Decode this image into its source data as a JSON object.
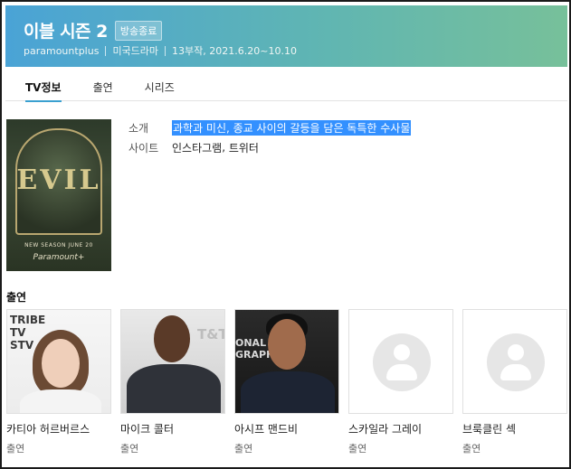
{
  "header": {
    "title": "이블 시즌 2",
    "badge": "방송종료",
    "network": "paramountplus",
    "genre": "미국드라마",
    "episodes_dates": "13부작, 2021.6.20~10.10"
  },
  "tabs": [
    {
      "label": "TV정보",
      "active": true
    },
    {
      "label": "출연",
      "active": false
    },
    {
      "label": "시리즈",
      "active": false
    }
  ],
  "poster": {
    "logo_text": "EVIL",
    "tagline": "NEW SEASON JUNE 20",
    "network_text": "Paramount+"
  },
  "info": {
    "synopsis_label": "소개",
    "synopsis_value": "과학과 미신, 종교 사이의 갈등을 담은 독특한 수사물",
    "site_label": "사이트",
    "site_links": [
      "인스타그램",
      "트위터"
    ],
    "site_separator": ", "
  },
  "cast": {
    "heading": "출연",
    "members": [
      {
        "name": "카티아 허르버르스",
        "role": "출연",
        "photo": "photo"
      },
      {
        "name": "마이크 콜터",
        "role": "출연",
        "photo": "photo"
      },
      {
        "name": "아시프 맨드비",
        "role": "출연",
        "photo": "photo"
      },
      {
        "name": "스카일라 그레이",
        "role": "출연",
        "photo": "placeholder"
      },
      {
        "name": "브룩클린 섹",
        "role": "출연",
        "photo": "placeholder"
      }
    ],
    "photo_backdrop_text": [
      "TRIBE\nTV\nSTV",
      "T&T",
      "ONAL\nGRAPHIC"
    ]
  },
  "colors": {
    "header_gradient_start": "#4aa3d6",
    "header_gradient_end": "#77c09a",
    "tab_active_underline": "#3aa0d0",
    "selection": "#3390ff"
  }
}
